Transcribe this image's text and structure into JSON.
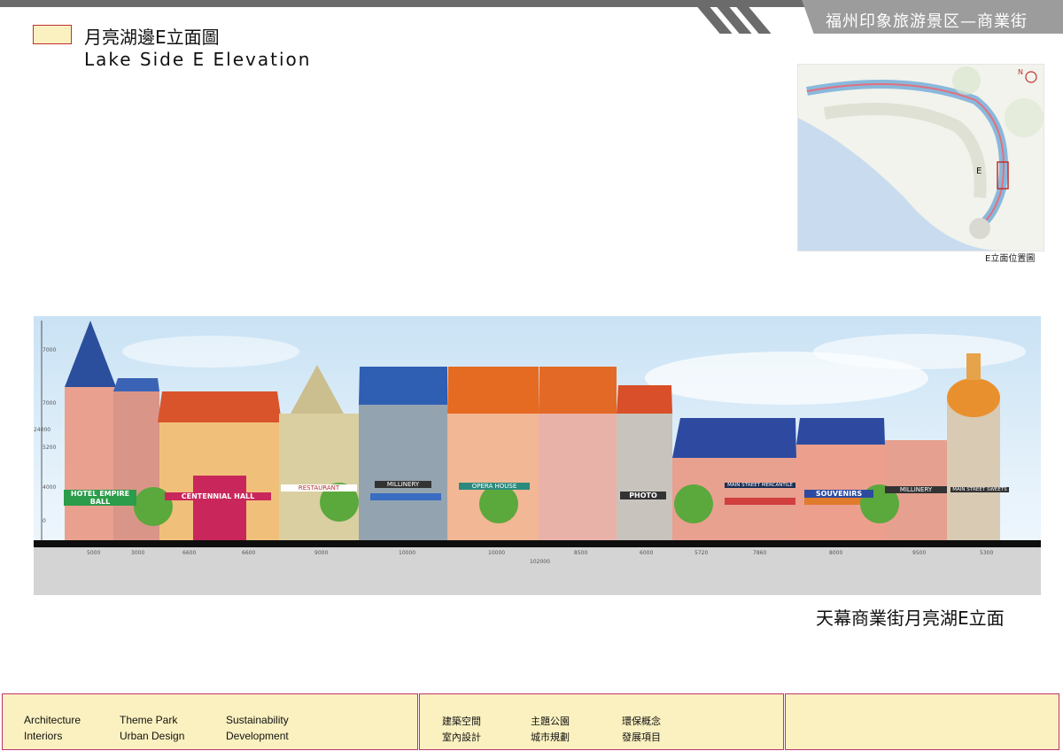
{
  "header": {
    "project_title": "福州印象旅游景区—商業街"
  },
  "title": {
    "cn": "月亮湖邊E立面圖",
    "en": "Lake Side E Elevation"
  },
  "key_map": {
    "north_label": "N",
    "marker": "E",
    "caption": "E立面位置圖"
  },
  "elevation": {
    "signs": [
      "HOTEL EMPIRE BALL",
      "CENTENNIAL HALL",
      "RESTAURANT",
      "MILLINERY",
      "OPERA HOUSE",
      "PHOTO",
      "MAIN STREET MERCANTILE",
      "SOUVENIRS",
      "MILLINERY",
      "MAIN STREET SWEETS"
    ],
    "dimensions": [
      "5000",
      "3000",
      "6600",
      "6600",
      "9000",
      "10000",
      "10000",
      "8500",
      "6000",
      "5720",
      "7860",
      "8000",
      "9500",
      "5300"
    ],
    "total_dimension": "102000",
    "height_marks": [
      "7000",
      "7000",
      "5200",
      "4000",
      "0"
    ],
    "total_height": "24000"
  },
  "caption": "天幕商業街月亮湖E立面",
  "footer": {
    "en": [
      [
        "Architecture",
        "Interiors"
      ],
      [
        "Theme Park",
        "Urban Design"
      ],
      [
        "Sustainability",
        "Development"
      ]
    ],
    "cn": [
      [
        "建築空間",
        "室內設計"
      ],
      [
        "主題公園",
        "城市規劃"
      ],
      [
        "環保概念",
        "發展項目"
      ]
    ]
  },
  "colors": {
    "accent": "#c0302f",
    "footer_bg": "#fbf1c0",
    "header_bar": "#6b6b6b"
  }
}
